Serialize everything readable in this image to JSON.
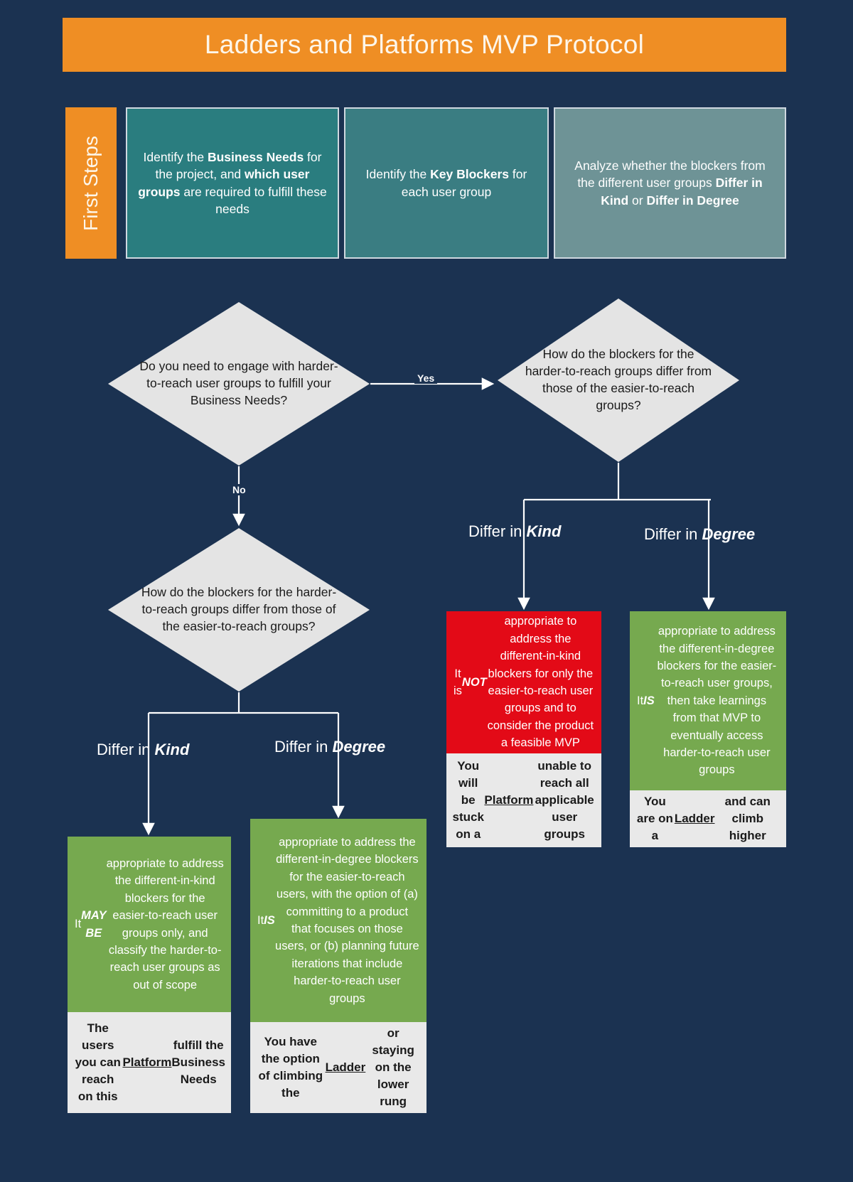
{
  "title": "Ladders and Platforms MVP Protocol",
  "colors": {
    "background": "#1b3251",
    "accent_orange": "#ef8e24",
    "teal_dark": "#2a7d7f",
    "teal_mid": "#3a7d82",
    "teal_light": "#6e9396",
    "red": "#e30a17",
    "green": "#76a94f",
    "diamond_fill": "#e4e4e4",
    "caption_fill": "#e9e9e9",
    "line": "#ffffff"
  },
  "first_steps": {
    "label": "First Steps",
    "steps": [
      {
        "id": "identify-business-needs",
        "segments": [
          {
            "text": "Identify the ",
            "bold": false
          },
          {
            "text": "Business Needs",
            "bold": true
          },
          {
            "text": " for the project, and ",
            "bold": false
          },
          {
            "text": "which user groups",
            "bold": true
          },
          {
            "text": " are required to fulfill these needs",
            "bold": false
          }
        ]
      },
      {
        "id": "identify-key-blockers",
        "segments": [
          {
            "text": "Identify the ",
            "bold": false
          },
          {
            "text": "Key Blockers",
            "bold": true
          },
          {
            "text": " for each user group",
            "bold": false
          }
        ]
      },
      {
        "id": "analyze-blockers",
        "segments": [
          {
            "text": "Analyze whether the blockers from the different user groups ",
            "bold": false
          },
          {
            "text": "Differ in Kind",
            "bold": true
          },
          {
            "text": " or ",
            "bold": false
          },
          {
            "text": "Differ in Degree",
            "bold": true
          }
        ]
      }
    ]
  },
  "decisions": {
    "need_engage": "Do you need to engage with harder-to-reach user groups to fulfill your Business Needs?",
    "how_differ_right": "How do the blockers for the harder-to-reach groups differ from those of the easier-to-reach groups?",
    "how_differ_left": "How do the blockers for the harder-to-reach groups differ from those of the easier-to-reach groups?"
  },
  "edges": {
    "yes": "Yes",
    "no": "No",
    "differ_kind_prefix": "Differ in ",
    "differ_kind_em": "Kind",
    "differ_degree_prefix": "Differ in ",
    "differ_degree_em": "Degree"
  },
  "outcomes": {
    "not_appropriate": {
      "body_segments": [
        {
          "text": "It is ",
          "style": "normal"
        },
        {
          "text": "NOT",
          "style": "bolditalic"
        },
        {
          "text": " appropriate to address the different-in-kind blockers for only the easier-to-reach user groups and to consider the product a feasible MVP",
          "style": "normal"
        }
      ],
      "caption_segments": [
        {
          "text": "You will be stuck on a ",
          "style": "bold"
        },
        {
          "text": "Platform",
          "style": "bold-underline"
        },
        {
          "text": " unable to reach all applicable user groups",
          "style": "bold"
        }
      ]
    },
    "is_appropriate_degree_right": {
      "body_segments": [
        {
          "text": "It ",
          "style": "normal"
        },
        {
          "text": "IS",
          "style": "bolditalic"
        },
        {
          "text": " appropriate to address the different-in-degree blockers for the easier-to-reach user groups, then take learnings from that MVP to eventually access harder-to-reach user groups",
          "style": "normal"
        }
      ],
      "caption_segments": [
        {
          "text": "You are on a ",
          "style": "bold"
        },
        {
          "text": "Ladder",
          "style": "bold-underline"
        },
        {
          "text": " and can climb higher",
          "style": "bold"
        }
      ]
    },
    "may_be_appropriate": {
      "body_segments": [
        {
          "text": "It ",
          "style": "normal"
        },
        {
          "text": "MAY BE",
          "style": "bolditalic"
        },
        {
          "text": " appropriate to address the different-in-kind blockers for  the easier-to-reach user groups only, and classify the harder-to-reach user groups  as out of scope",
          "style": "normal"
        }
      ],
      "caption_segments": [
        {
          "text": "The users you can reach on this ",
          "style": "bold"
        },
        {
          "text": "Platform",
          "style": "bold-underline"
        },
        {
          "text": " fulfill the Business Needs",
          "style": "bold"
        }
      ]
    },
    "is_appropriate_degree_left": {
      "body_segments": [
        {
          "text": "It ",
          "style": "normal"
        },
        {
          "text": "IS",
          "style": "bolditalic"
        },
        {
          "text": " appropriate to address the different-in-degree blockers for the easier-to-reach users, with the option of (a) committing to a product that focuses on those users, or (b) planning future iterations that include harder-to-reach user groups",
          "style": "normal"
        }
      ],
      "caption_segments": [
        {
          "text": "You have the option of climbing the ",
          "style": "bold"
        },
        {
          "text": "Ladder",
          "style": "bold-underline"
        },
        {
          "text": " or staying on the lower rung",
          "style": "bold"
        }
      ]
    }
  }
}
